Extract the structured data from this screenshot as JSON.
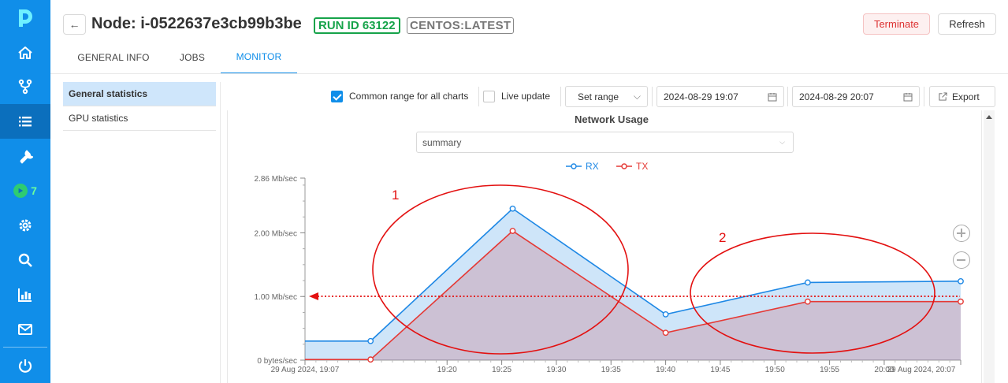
{
  "rail": {
    "items": [
      "home-icon",
      "fork-icon",
      "list-icon",
      "tool-icon",
      "run-icon",
      "gear-icon",
      "search-icon",
      "chart-icon",
      "mail-icon",
      "power-icon"
    ],
    "active": "list-icon",
    "runs_badge": "7",
    "accent": "#108ee9"
  },
  "header": {
    "back": "←",
    "title": "Node: i-0522637e3cb99b3be",
    "run_tag": "RUN ID 63122",
    "os_tag": "CENTOS:LATEST",
    "terminate": "Terminate",
    "refresh": "Refresh"
  },
  "tabs": [
    {
      "label": "GENERAL INFO"
    },
    {
      "label": "JOBS"
    },
    {
      "label": "MONITOR",
      "active": true
    }
  ],
  "sidebar": {
    "items": [
      {
        "label": "General statistics",
        "active": true
      },
      {
        "label": "GPU statistics"
      }
    ]
  },
  "toolbar": {
    "common_range": "Common range for all charts",
    "common_range_checked": true,
    "live_update": "Live update",
    "live_update_checked": false,
    "set_range": "Set range",
    "from": "2024-08-29 19:07",
    "to": "2024-08-29 20:07",
    "export": "Export"
  },
  "chart": {
    "select_value": "summary"
  },
  "annotations": {
    "label1": "1",
    "label2": "2",
    "color": "#e31010"
  },
  "chart_data": {
    "type": "area",
    "title": "Network Usage",
    "x_ticks": [
      "29 Aug 2024, 19:07",
      "19:20",
      "19:25",
      "19:30",
      "19:35",
      "19:40",
      "19:45",
      "19:50",
      "19:55",
      "20:00",
      "29 Aug 2024, 20:07"
    ],
    "y_ticks": [
      "0 bytes/sec",
      "1.00 Mb/sec",
      "2.00 Mb/sec",
      "2.86 Mb/sec"
    ],
    "ylim": [
      0,
      2.86
    ],
    "legend": "top-center",
    "series": [
      {
        "name": "RX",
        "color": "#1e88e5",
        "x": [
          "19:07",
          "19:13",
          "19:26",
          "19:40",
          "19:53",
          "20:07"
        ],
        "values": [
          0.3,
          0.3,
          2.38,
          0.72,
          1.22,
          1.24
        ]
      },
      {
        "name": "TX",
        "color": "#e53935",
        "x": [
          "19:07",
          "19:13",
          "19:26",
          "19:40",
          "19:53",
          "20:07"
        ],
        "values": [
          0.01,
          0.01,
          2.03,
          0.43,
          0.92,
          0.92
        ]
      }
    ]
  }
}
